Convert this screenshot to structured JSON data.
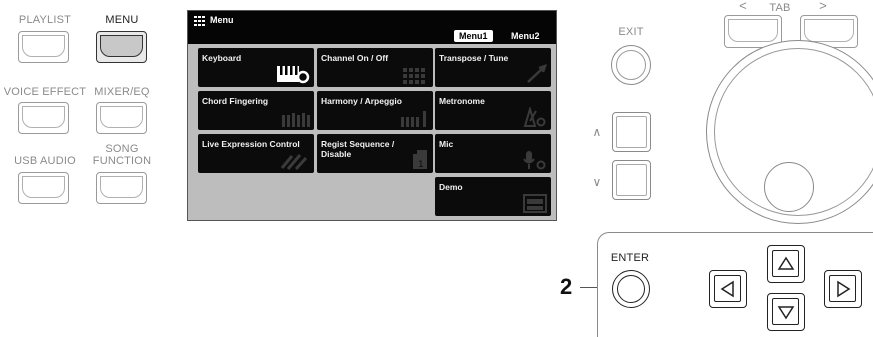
{
  "left_panel": {
    "playlist_label": "PLAYLIST",
    "menu_label": "MENU",
    "voice_effect_label": "VOICE EFFECT",
    "mixer_eq_label": "MIXER/EQ",
    "usb_audio_label": "USB AUDIO",
    "song_function_label_1": "SONG",
    "song_function_label_2": "FUNCTION"
  },
  "screen": {
    "title": "Menu",
    "tabs": [
      "Menu1",
      "Menu2"
    ],
    "selected_tab": "Menu1",
    "items": [
      {
        "label": "Keyboard",
        "icon": "keyboard-gear-icon"
      },
      {
        "label": "Channel On / Off",
        "icon": "channel-grid-icon"
      },
      {
        "label": "Transpose / Tune",
        "icon": "tune-icon"
      },
      {
        "label": "Chord Fingering",
        "icon": "chord-keyboard-icon"
      },
      {
        "label": "Harmony / Arpeggio",
        "icon": "harmony-icon"
      },
      {
        "label": "Metronome",
        "icon": "metronome-icon"
      },
      {
        "label": "Live Expression Control",
        "icon": "live-expression-icon"
      },
      {
        "label_1": "Regist Sequence /",
        "label_2": "Disable",
        "icon": "regist-icon"
      },
      {
        "label": "Mic",
        "icon": "mic-icon"
      },
      {
        "label": "Demo",
        "icon": "demo-icon"
      }
    ]
  },
  "right_panel": {
    "exit_label": "EXIT",
    "tab_label": "TAB",
    "tab_prev": "<",
    "tab_next": ">",
    "up_label": "∧",
    "down_label": "∨",
    "enter_label": "ENTER",
    "step_number": "2"
  }
}
